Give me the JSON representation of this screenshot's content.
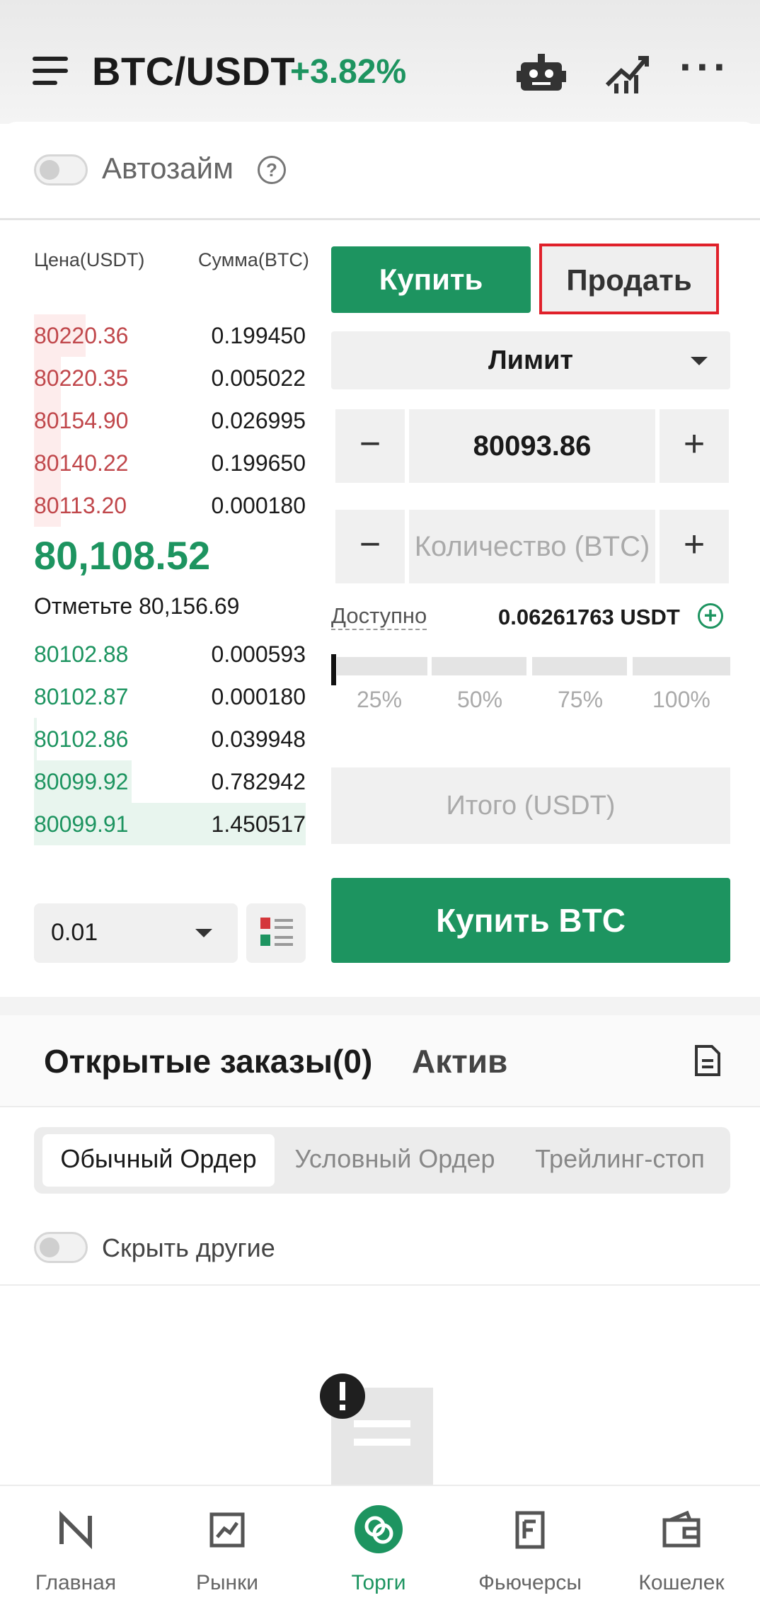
{
  "header": {
    "pair": "BTC/USDT",
    "change": "+3.82%",
    "more_label": "···",
    "accent_color": "#1d9460"
  },
  "autoloan": {
    "label": "Автозайм",
    "help": "?",
    "enabled": false
  },
  "orderbook": {
    "price_header": "Цена(USDT)",
    "amount_header": "Сумма(BTC)",
    "asks": [
      {
        "price": "80220.36",
        "amount": "0.199450",
        "depth": 0.19
      },
      {
        "price": "80220.35",
        "amount": "0.005022",
        "depth": 0.1
      },
      {
        "price": "80154.90",
        "amount": "0.026995",
        "depth": 0.1
      },
      {
        "price": "80140.22",
        "amount": "0.199650",
        "depth": 0.1
      },
      {
        "price": "80113.20",
        "amount": "0.000180",
        "depth": 0.1
      }
    ],
    "last_price": "80,108.52",
    "mark_price": "Отметьте 80,156.69",
    "bids": [
      {
        "price": "80102.88",
        "amount": "0.000593",
        "depth": 0
      },
      {
        "price": "80102.87",
        "amount": "0.000180",
        "depth": 0
      },
      {
        "price": "80102.86",
        "amount": "0.039948",
        "depth": 0.01
      },
      {
        "price": "80099.92",
        "amount": "0.782942",
        "depth": 0.36
      },
      {
        "price": "80099.91",
        "amount": "1.450517",
        "depth": 1.0
      }
    ],
    "precision": "0.01"
  },
  "trade": {
    "buy_tab": "Купить",
    "sell_tab": "Продать",
    "order_type": "Лимит",
    "price_value": "80093.86",
    "quantity_placeholder": "Количество (BTC)",
    "minus": "−",
    "plus": "+",
    "available_label": "Доступно",
    "available_value": "0.06261763 USDT",
    "add": "+",
    "slider_position": 0,
    "slider_labels": [
      "25%",
      "50%",
      "75%",
      "100%"
    ],
    "total_placeholder": "Итого (USDT)",
    "submit": "Купить BTC"
  },
  "orders": {
    "tab_open": "Открытые заказы(0)",
    "tab_assets": "Актив",
    "segments": [
      "Обычный Ордер",
      "Условный Ордер",
      "Трейлинг-стоп"
    ],
    "hide_others": "Скрыть другие"
  },
  "bottom_nav": [
    {
      "label": "Главная",
      "icon": "home-icon"
    },
    {
      "label": "Рынки",
      "icon": "markets-icon"
    },
    {
      "label": "Торги",
      "icon": "trade-icon"
    },
    {
      "label": "Фьючерсы",
      "icon": "futures-icon"
    },
    {
      "label": "Кошелек",
      "icon": "wallet-icon"
    }
  ]
}
